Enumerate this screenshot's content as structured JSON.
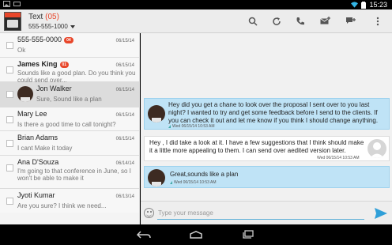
{
  "status_bar": {
    "time": "15:23"
  },
  "header": {
    "title": "Text",
    "count": "(05)",
    "subtitle": "555-555-1000",
    "logo_text": "xfinity"
  },
  "toolbar": {
    "icons": [
      "search-icon",
      "refresh-icon",
      "call-icon",
      "new-message-icon",
      "new-conversation-icon",
      "overflow-menu-icon"
    ]
  },
  "threads": [
    {
      "name": "555-555-0000",
      "badge": "04",
      "date": "06/15/14",
      "snippet": "Ok",
      "bold": false
    },
    {
      "name": "James King",
      "badge": "01",
      "date": "06/15/14",
      "snippet": "Sounds like a good plan. Do you think you could send over...",
      "bold": true
    },
    {
      "name": "Jon Walker",
      "badge": "",
      "date": "06/15/14",
      "snippet": "Sure, Sound like a plan",
      "bold": false
    },
    {
      "name": "Mary Lee",
      "badge": "",
      "date": "06/15/14",
      "snippet": "Is there a good time to call tonight?",
      "bold": false
    },
    {
      "name": "Brian Adams",
      "badge": "",
      "date": "06/15/14",
      "snippet": "I cant Make it today",
      "bold": false
    },
    {
      "name": "Ana D'Souza",
      "badge": "",
      "date": "06/14/14",
      "snippet": "I'm going to that conference in June, so I won't be able to make it",
      "bold": false
    },
    {
      "name": "Jyoti Kumar",
      "badge": "",
      "date": "06/13/14",
      "snippet": "Are you sure? I think we need...",
      "bold": false
    }
  ],
  "messages": [
    {
      "direction": "in",
      "text_1": "Hey did you get a chane to look over the proposal I sent over to you last",
      "text_2": "night? I wanted to try and get some feedback before I send to the clients. If",
      "text_3": "you can check it out and let me know if you think I should change anything.",
      "meta": "Wed 06/15/14 10:53 AM"
    },
    {
      "direction": "out",
      "text_1": "Hey , I did take a look at it. I have a few suggestions that I think should make",
      "text_2": "it a little more appealing to them. I can send over aedited version later.",
      "meta": "Wed 06/15/14 10:53 AM"
    },
    {
      "direction": "in",
      "text_1": "Great,sounds like a plan",
      "meta": "Wed 06/15/14 10:53 AM"
    }
  ],
  "compose": {
    "placeholder": "Type your message"
  },
  "colors": {
    "accent": "#e8462a",
    "incoming_bubble": "#bfe3f6",
    "send": "#2f9fd8"
  }
}
